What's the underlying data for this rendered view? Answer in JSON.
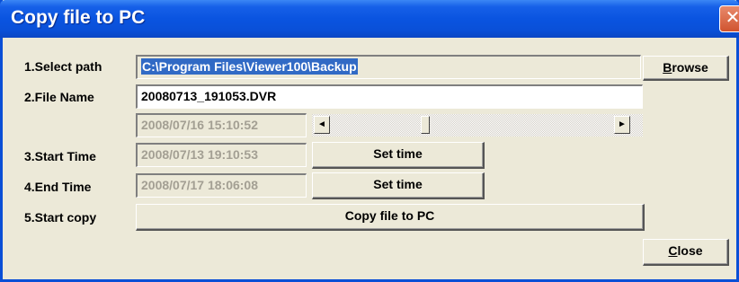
{
  "window": {
    "title": "Copy file to PC",
    "close_glyph": "✕"
  },
  "labels": {
    "select_path": "1.Select path",
    "file_name": "2.File Name",
    "start_time": "3.Start Time",
    "end_time": "4.End Time",
    "start_copy": "5.Start copy"
  },
  "fields": {
    "path": "C:\\Program Files\\Viewer100\\Backup",
    "file_name": "20080713_191053.DVR",
    "current_time": "2008/07/16 15:10:52",
    "start_time": "2008/07/13 19:10:53",
    "end_time": "2008/07/17 18:06:08"
  },
  "buttons": {
    "browse_mnemonic": "B",
    "browse_rest": "rowse",
    "set_time_start": "Set time",
    "set_time_end": "Set time",
    "copy": "Copy file to PC",
    "close_mnemonic": "C",
    "close_rest": "lose"
  },
  "scrollbar": {
    "left_arrow": "◄",
    "right_arrow": "►",
    "position_fraction": 0.33
  },
  "colors": {
    "titlebar": "#0a54e0",
    "selection": "#316ac5",
    "dialog_bg": "#ece9d8"
  }
}
